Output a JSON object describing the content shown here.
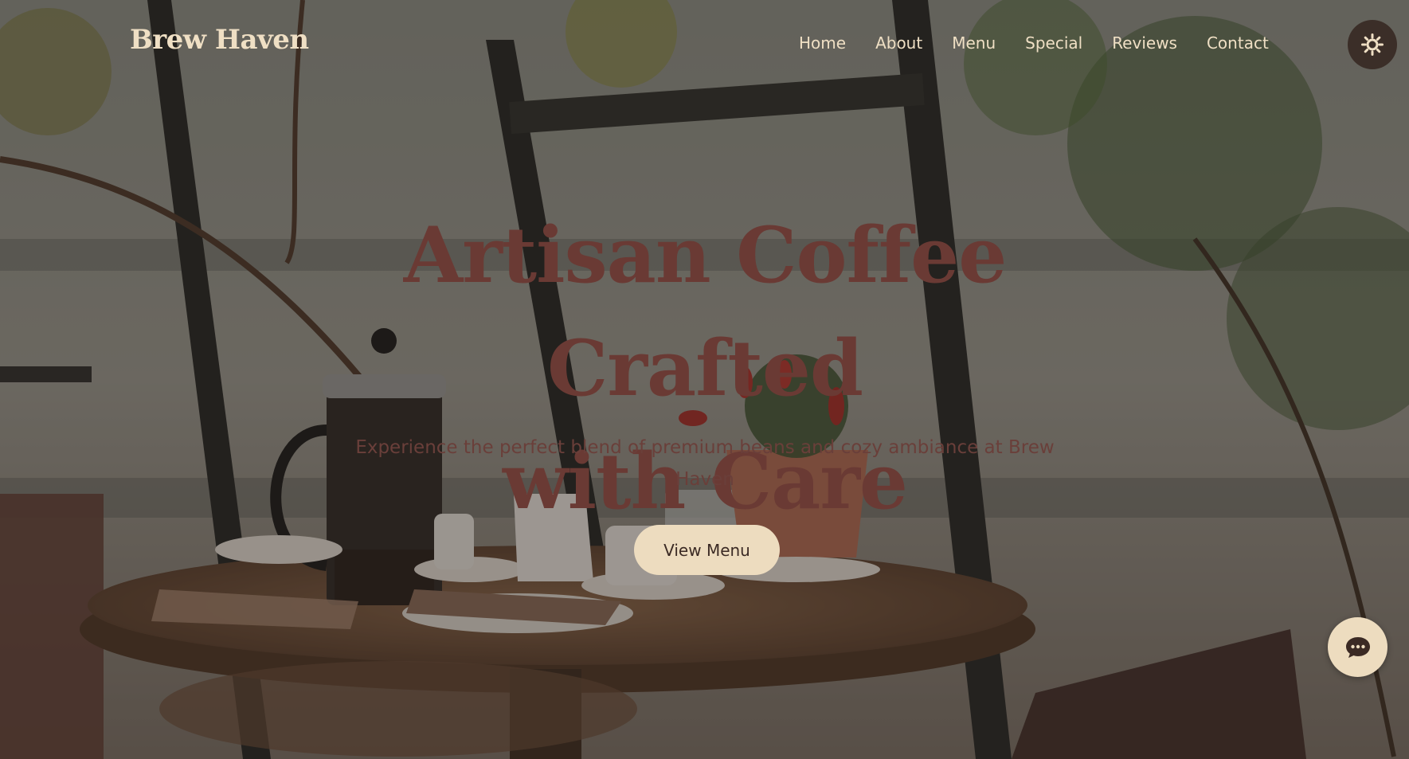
{
  "brand": {
    "name": "Brew Haven"
  },
  "nav": {
    "links": [
      {
        "label": "Home"
      },
      {
        "label": "About"
      },
      {
        "label": "Menu"
      },
      {
        "label": "Special"
      },
      {
        "label": "Reviews"
      },
      {
        "label": "Contact"
      }
    ],
    "theme_toggle_icon": "sun-icon"
  },
  "hero": {
    "title_line1": "Artisan Coffee Crafted",
    "title_line2": "with Care",
    "subtitle_line1": "Experience the perfect blend of premium beans and cozy ambiance at Brew",
    "subtitle_line2": "Haven",
    "cta_label": "View Menu"
  },
  "chat": {
    "icon": "chat-bubble-icon"
  },
  "colors": {
    "accent": "#eddcbf",
    "title": "#6a3a34",
    "nav_text": "#efdfc4",
    "toggle_bg": "#3b2e28"
  }
}
